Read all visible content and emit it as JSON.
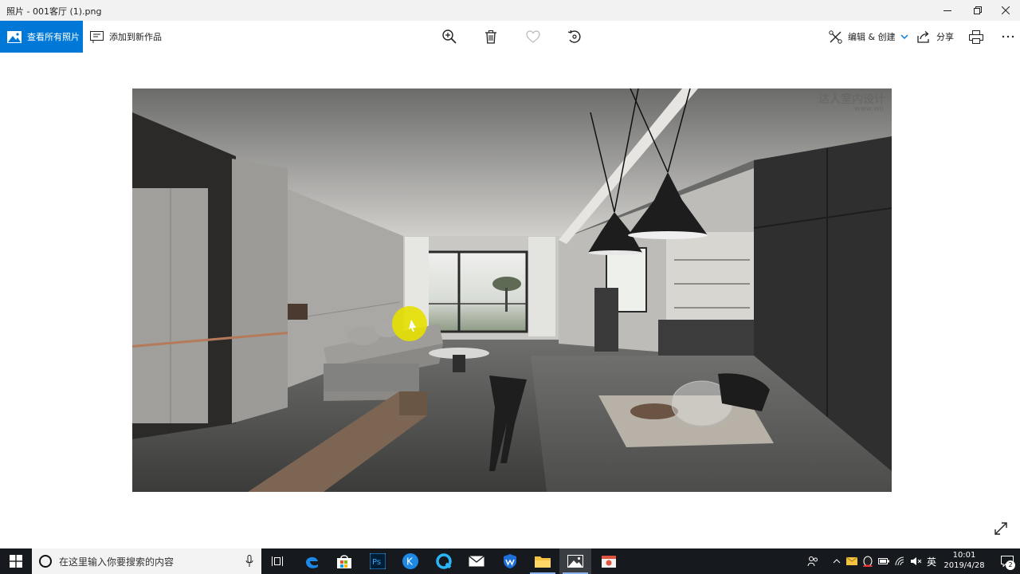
{
  "window": {
    "title": "照片 - 001客厅 (1).png",
    "controls": {
      "minimize": "minimize",
      "restore": "restore",
      "close": "close"
    }
  },
  "toolbar": {
    "view_all_label": "查看所有照片",
    "add_to_creation_label": "添加到新作品",
    "center_icons": [
      "zoom-in-icon",
      "delete-icon",
      "favorite-heart-icon",
      "rotate-icon"
    ],
    "edit_create_label": "编辑 & 创建",
    "share_label": "分享",
    "print_icon": "print-icon",
    "more_icon": "more-icon"
  },
  "photo": {
    "description_icon": "living-room-interior-photo",
    "watermark_cn": "达人室内设计",
    "watermark_url": "www.wo"
  },
  "taskbar": {
    "search_placeholder": "在这里输入你要搜索的内容",
    "apps": [
      "task-view",
      "edge",
      "store",
      "photoshop",
      "kugou",
      "qq-browser",
      "mail",
      "wps",
      "file-explorer",
      "photos",
      "office"
    ],
    "active_app": "photos",
    "ime": "英",
    "clock_time": "10:01",
    "clock_date": "2019/4/28",
    "notification_count": "2"
  },
  "colors": {
    "accent": "#0078d7",
    "taskbar": "#16191e",
    "titlebar": "#f2f2f2"
  }
}
